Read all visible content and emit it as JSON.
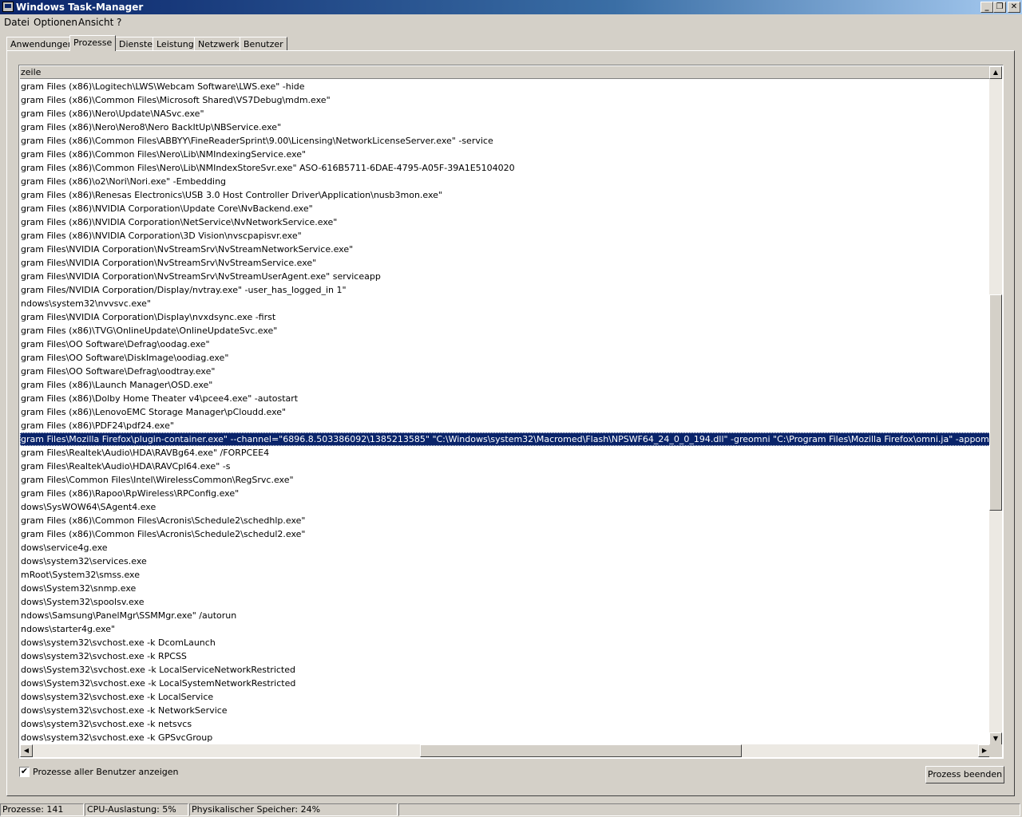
{
  "window": {
    "title": "Windows Task-Manager"
  },
  "menu": [
    "Datei",
    "Optionen",
    "Ansicht",
    "?"
  ],
  "tabs": [
    {
      "label": "Anwendungen",
      "active": false
    },
    {
      "label": "Prozesse",
      "active": true
    },
    {
      "label": "Dienste",
      "active": false
    },
    {
      "label": "Leistung",
      "active": false
    },
    {
      "label": "Netzwerk",
      "active": false
    },
    {
      "label": "Benutzer",
      "active": false
    }
  ],
  "list": {
    "column_header": "zeile",
    "selected_index": 26,
    "rows": [
      "gram Files (x86)\\Logitech\\LWS\\Webcam Software\\LWS.exe\" -hide",
      "gram Files (x86)\\Common Files\\Microsoft Shared\\VS7Debug\\mdm.exe\"",
      "gram Files (x86)\\Nero\\Update\\NASvc.exe\"",
      "gram Files (x86)\\Nero\\Nero8\\Nero BackItUp\\NBService.exe\"",
      "gram Files (x86)\\Common Files\\ABBYY\\FineReaderSprint\\9.00\\Licensing\\NetworkLicenseServer.exe\" -service",
      "gram Files (x86)\\Common Files\\Nero\\Lib\\NMIndexingService.exe\"",
      "gram Files (x86)\\Common Files\\Nero\\Lib\\NMIndexStoreSvr.exe\" ASO-616B5711-6DAE-4795-A05F-39A1E5104020",
      "gram Files (x86)\\o2\\Nori\\Nori.exe\" -Embedding",
      "gram Files (x86)\\Renesas Electronics\\USB 3.0 Host Controller Driver\\Application\\nusb3mon.exe\"",
      "gram Files (x86)\\NVIDIA Corporation\\Update Core\\NvBackend.exe\"",
      "gram Files (x86)\\NVIDIA Corporation\\NetService\\NvNetworkService.exe\"",
      "gram Files (x86)\\NVIDIA Corporation\\3D Vision\\nvscpapisvr.exe\"",
      "gram Files\\NVIDIA Corporation\\NvStreamSrv\\NvStreamNetworkService.exe\"",
      "gram Files\\NVIDIA Corporation\\NvStreamSrv\\NvStreamService.exe\"",
      "gram Files\\NVIDIA Corporation\\NvStreamSrv\\NvStreamUserAgent.exe\" serviceapp",
      "gram Files/NVIDIA Corporation/Display/nvtray.exe\" -user_has_logged_in 1\"",
      "ndows\\system32\\nvvsvc.exe\"",
      "gram Files\\NVIDIA Corporation\\Display\\nvxdsync.exe  -first",
      "gram Files (x86)\\TVG\\OnlineUpdate\\OnlineUpdateSvc.exe\"",
      "gram Files\\OO Software\\Defrag\\oodag.exe\"",
      "gram Files\\OO Software\\DiskImage\\oodiag.exe\"",
      "gram Files\\OO Software\\Defrag\\oodtray.exe\"",
      "gram Files (x86)\\Launch Manager\\OSD.exe\"",
      "gram Files (x86)\\Dolby Home Theater v4\\pcee4.exe\" -autostart",
      "gram Files (x86)\\LenovoEMC Storage Manager\\pCloudd.exe\"",
      "gram Files (x86)\\PDF24\\pdf24.exe\"",
      "gram Files\\Mozilla Firefox\\plugin-container.exe\" --channel=\"6896.8.503386092\\1385213585\" \"C:\\Windows\\system32\\Macromed\\Flash\\NPSWF64_24_0_0_194.dll\" -greomni \"C:\\Program Files\\Mozilla Firefox\\omni.ja\" -appomni \"C:\\Program Files\\Mozilla Fire",
      "gram Files\\Realtek\\Audio\\HDA\\RAVBg64.exe\" /FORPCEE4",
      "gram Files\\Realtek\\Audio\\HDA\\RAVCpl64.exe\" -s",
      "gram Files\\Common Files\\Intel\\WirelessCommon\\RegSrvc.exe\"",
      "gram Files (x86)\\Rapoo\\RpWireless\\RPConfig.exe\"",
      "dows\\SysWOW64\\SAgent4.exe",
      "gram Files (x86)\\Common Files\\Acronis\\Schedule2\\schedhlp.exe\"",
      "gram Files (x86)\\Common Files\\Acronis\\Schedule2\\schedul2.exe\"",
      "dows\\service4g.exe",
      "dows\\system32\\services.exe",
      "mRoot\\System32\\smss.exe",
      "dows\\System32\\snmp.exe",
      "dows\\System32\\spoolsv.exe",
      "ndows\\Samsung\\PanelMgr\\SSMMgr.exe\" /autorun",
      "ndows\\starter4g.exe\"",
      "dows\\system32\\svchost.exe -k DcomLaunch",
      "dows\\system32\\svchost.exe -k RPCSS",
      "dows\\System32\\svchost.exe -k LocalServiceNetworkRestricted",
      "dows\\System32\\svchost.exe -k LocalSystemNetworkRestricted",
      "dows\\system32\\svchost.exe -k LocalService",
      "dows\\system32\\svchost.exe -k NetworkService",
      "dows\\system32\\svchost.exe -k netsvcs",
      "dows\\system32\\svchost.exe -k GPSvcGroup"
    ]
  },
  "checkbox": {
    "label": "Prozesse aller Benutzer anzeigen",
    "checked": true
  },
  "end_process_button": "Prozess beenden",
  "status": {
    "processes": "Prozesse: 141",
    "cpu": "CPU-Auslastung: 5%",
    "memory": "Physikalischer Speicher: 24%"
  },
  "scroll": {
    "vertical_position": 0.33,
    "vertical_visible_fraction": 0.33,
    "horizontal_position": 0.41,
    "horizontal_visible_fraction": 0.34
  },
  "colors": {
    "selection": "#0a246a",
    "face": "#d4d0c8"
  }
}
